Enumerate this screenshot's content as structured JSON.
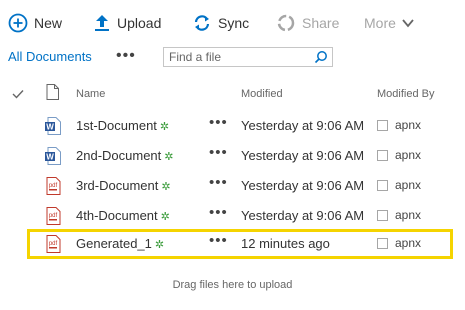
{
  "toolbar": {
    "new_label": "New",
    "upload_label": "Upload",
    "sync_label": "Sync",
    "share_label": "Share",
    "more_label": "More"
  },
  "view": {
    "current_view": "All Documents",
    "menu_dots": "•••",
    "search_placeholder": "Find a file"
  },
  "columns": {
    "name": "Name",
    "modified": "Modified",
    "modified_by": "Modified By"
  },
  "files": [
    {
      "name": "1st-Document",
      "type": "word-doc-icon",
      "new_marker": "✲",
      "dots": "•••",
      "modified": "Yesterday at 9:06 AM",
      "modified_by": "apnx"
    },
    {
      "name": "2nd-Document",
      "type": "word-doc-icon",
      "new_marker": "✲",
      "dots": "•••",
      "modified": "Yesterday at 9:06 AM",
      "modified_by": "apnx"
    },
    {
      "name": "3rd-Document",
      "type": "pdf-doc-icon",
      "new_marker": "✲",
      "dots": "•••",
      "modified": "Yesterday at 9:06 AM",
      "modified_by": "apnx"
    },
    {
      "name": "4th-Document",
      "type": "pdf-doc-icon",
      "new_marker": "✲",
      "dots": "•••",
      "modified": "Yesterday at 9:06 AM",
      "modified_by": "apnx"
    },
    {
      "name": "Generated_1",
      "type": "pdf-doc-icon",
      "new_marker": "✲",
      "dots": "•••",
      "modified": "12 minutes ago",
      "modified_by": "apnx"
    }
  ],
  "drag_hint": "Drag files here to upload",
  "colors": {
    "accent": "#0072c6",
    "highlight": "#f5d400",
    "new_marker": "#3a9b3a",
    "pdf": "#c0392b",
    "word": "#2b579a"
  }
}
